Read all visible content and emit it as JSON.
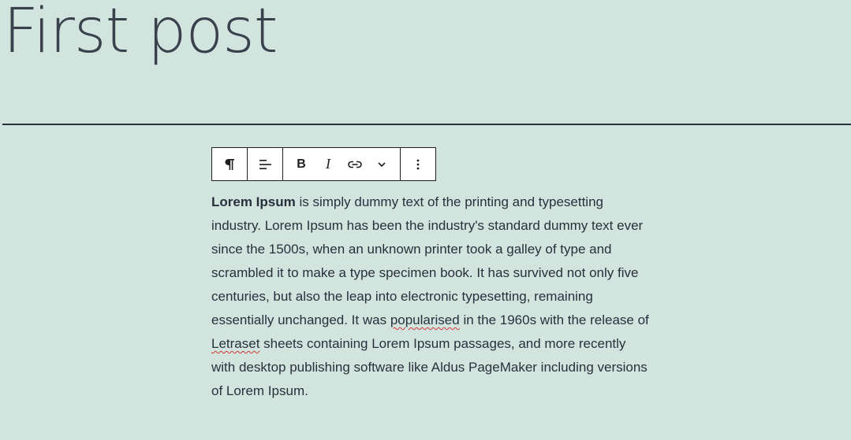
{
  "post": {
    "title": "First post"
  },
  "toolbar": {
    "paragraph_icon": "paragraph-icon",
    "align_icon": "align-left-icon",
    "bold_label": "B",
    "italic_label": "I",
    "link_icon": "link-icon",
    "more_icon": "chevron-down-icon",
    "options_icon": "more-vertical-icon"
  },
  "paragraph": {
    "bold_lead": "Lorem Ipsum",
    "text_1": " is simply dummy text of the printing and typesetting industry. Lorem Ipsum has been the industry's standard dummy text ever since the 1500s, when an unknown printer took a galley of type and scrambled it to make a type specimen book. It has survived not only five centuries, but also the leap into electronic typesetting, remaining essentially unchanged. It was ",
    "misspelled_1": "popularised",
    "text_2": " in the 1960s with the release of ",
    "misspelled_2": "Letraset",
    "text_3": " sheets containing Lorem Ipsum passages, and more recently with desktop publishing software like Aldus PageMaker including versions of Lorem Ipsum."
  },
  "colors": {
    "background": "#d1e4dd",
    "text": "#28303d",
    "toolbar_border": "#1e1e1e",
    "spellcheck": "#d63638"
  }
}
